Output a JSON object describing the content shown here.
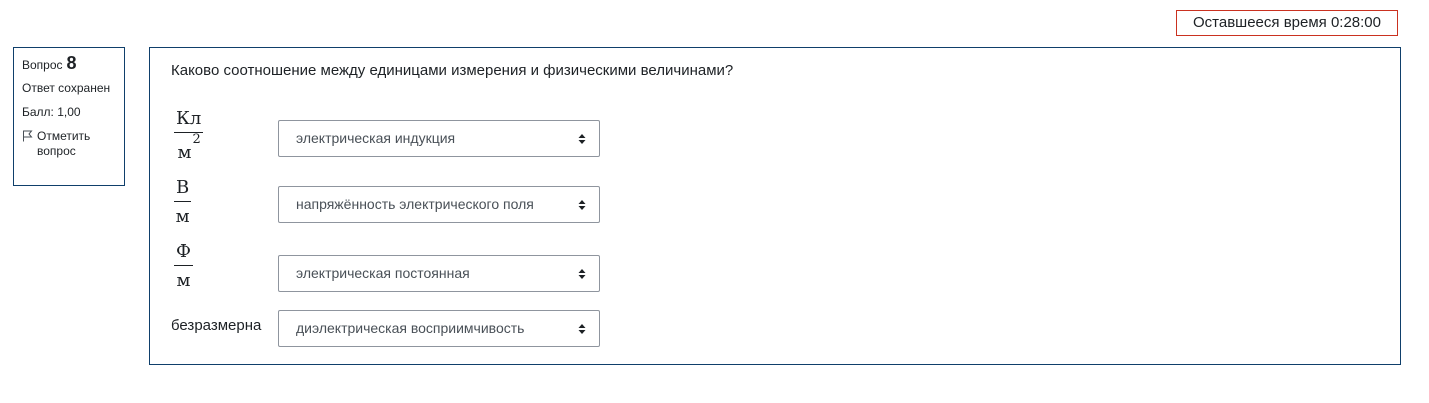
{
  "timer": {
    "label": "Оставшееся время 0:28:00"
  },
  "info": {
    "question_label": "Вопрос",
    "question_number": "8",
    "state": "Ответ сохранен",
    "grade": "Балл: 1,00",
    "flag_label": "Отметить вопрос"
  },
  "question": {
    "text": "Каково соотношение между единицами измерения и физическими величинами?",
    "rows": [
      {
        "numerator": "Кл",
        "denominator": "м",
        "exponent": "2",
        "selected": "электрическая индукция"
      },
      {
        "numerator": "В",
        "denominator": "м",
        "selected": "напряжённость электрического поля"
      },
      {
        "numerator": "Ф",
        "denominator": "м",
        "selected": "электрическая постоянная"
      },
      {
        "label": "безразмерна",
        "selected": "диэлектрическая восприимчивость"
      }
    ]
  },
  "colors": {
    "timer_border": "#ca3120",
    "box_border": "#0f3f6b",
    "select_border": "#8f959e"
  }
}
